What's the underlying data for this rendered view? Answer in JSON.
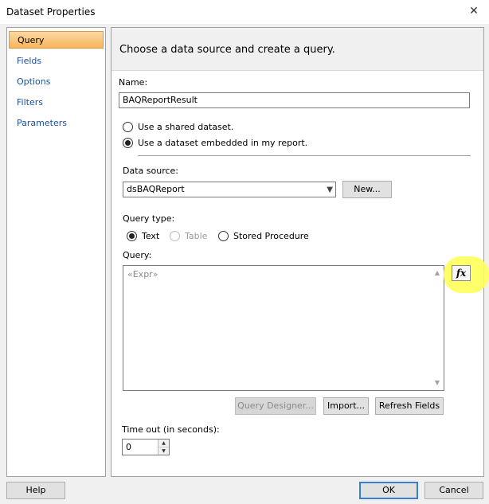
{
  "window": {
    "title": "Dataset Properties",
    "close_glyph": "✕"
  },
  "nav": {
    "items": [
      {
        "label": "Query",
        "selected": true
      },
      {
        "label": "Fields"
      },
      {
        "label": "Options"
      },
      {
        "label": "Filters"
      },
      {
        "label": "Parameters"
      }
    ]
  },
  "header": {
    "text": "Choose a data source and create a query."
  },
  "name": {
    "label": "Name:",
    "value": "BAQReportResult"
  },
  "dataset_choice": {
    "shared_label": "Use a shared dataset.",
    "embedded_label": "Use a dataset embedded in my report.",
    "selected": "embedded"
  },
  "data_source": {
    "label": "Data source:",
    "value": "dsBAQReport",
    "new_button": "New..."
  },
  "query_type": {
    "label": "Query type:",
    "options": [
      "Text",
      "Table",
      "Stored Procedure"
    ],
    "selected": "Text"
  },
  "query": {
    "label": "Query:",
    "placeholder": "«Expr»",
    "fx_label": "fx"
  },
  "query_buttons": {
    "designer": "Query Designer...",
    "import": "Import...",
    "refresh": "Refresh Fields"
  },
  "timeout": {
    "label": "Time out (in seconds):",
    "value": "0"
  },
  "footer": {
    "help": "Help",
    "ok": "OK",
    "cancel": "Cancel"
  },
  "colors": {
    "selection_orange": "#f7b55b",
    "highlight_yellow": "#ffff5a",
    "link_blue": "#1a4f9c"
  }
}
